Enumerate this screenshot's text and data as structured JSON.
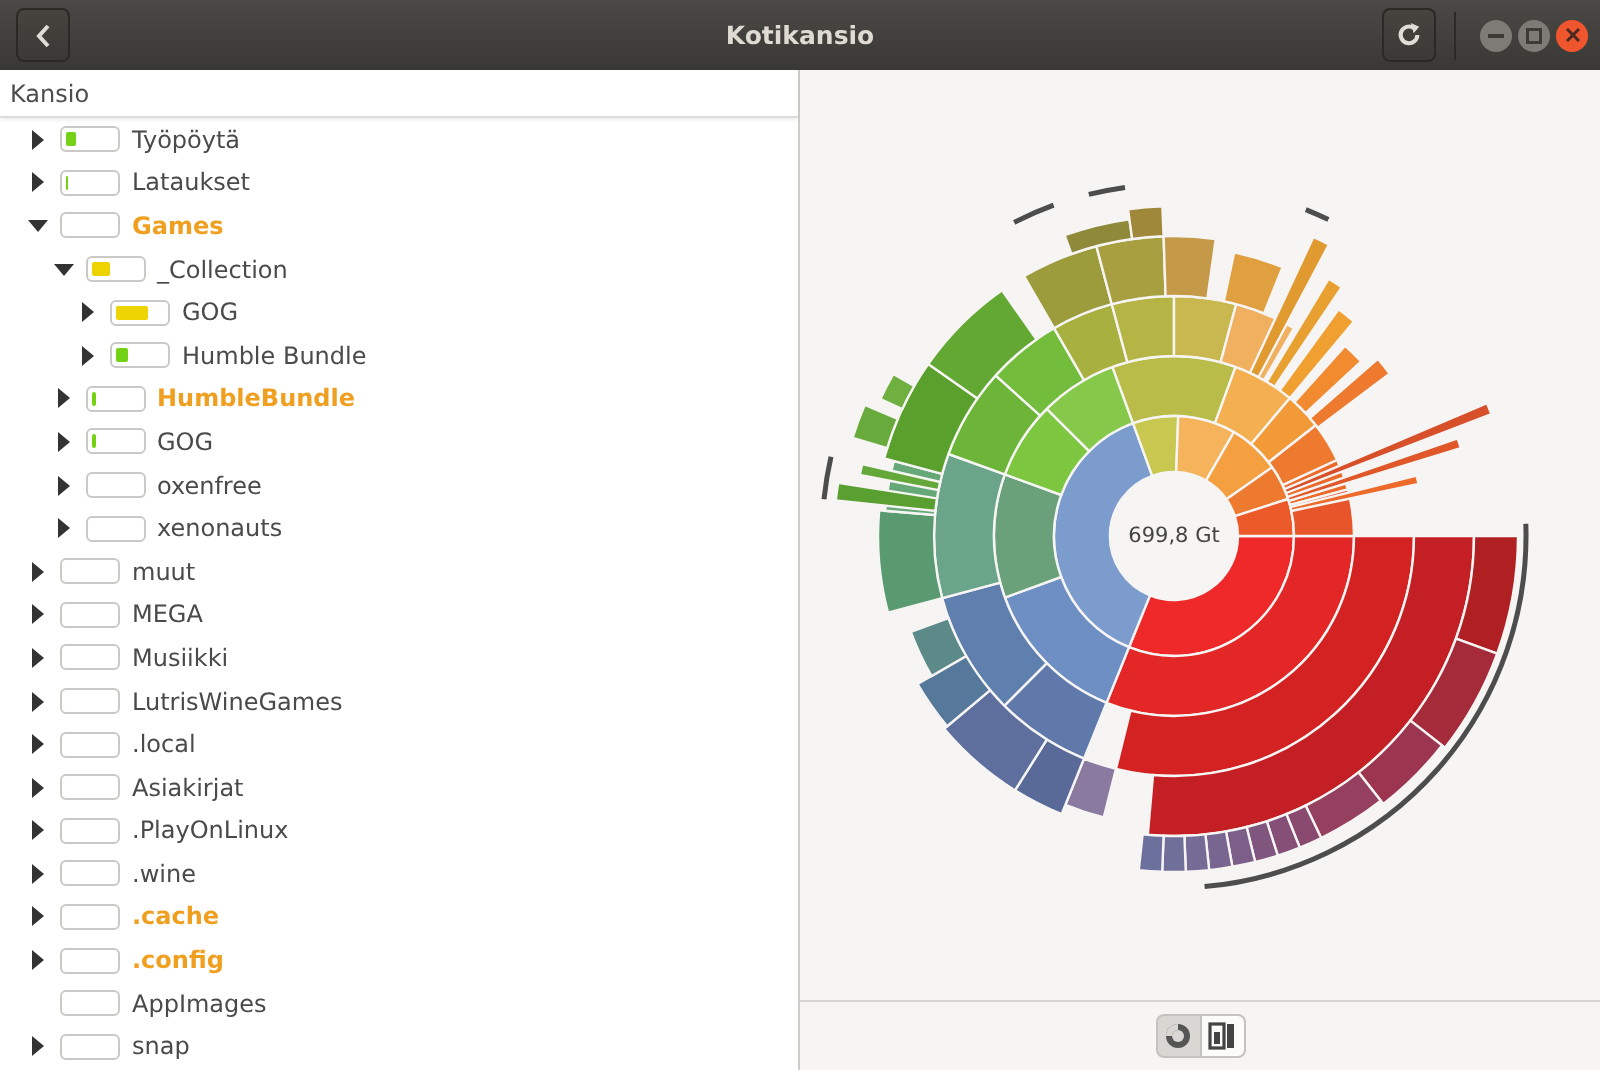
{
  "window": {
    "title": "Kotikansio"
  },
  "tree": {
    "column_header": "Kansio",
    "rows": [
      {
        "name": "Työpöytä",
        "level": 0.2,
        "color": "#73d216",
        "expandable": true,
        "expanded": false,
        "highlighted": false
      },
      {
        "name": "Lataukset",
        "level": 0.06,
        "color": "#73d216",
        "expandable": true,
        "expanded": false,
        "highlighted": false
      },
      {
        "name": "Games",
        "expandable": true,
        "expanded": true,
        "highlighted": true,
        "children": [
          {
            "name": "_Collection",
            "level": 0.4,
            "color": "#edd400",
            "expandable": true,
            "expanded": true,
            "highlighted": false,
            "children": [
              {
                "name": "GOG",
                "level": 0.65,
                "color": "#edd400",
                "expandable": true,
                "expanded": false,
                "highlighted": false
              },
              {
                "name": "Humble Bundle",
                "level": 0.25,
                "color": "#73d216",
                "expandable": true,
                "expanded": false,
                "highlighted": false
              }
            ]
          },
          {
            "name": "HumbleBundle",
            "level": 0.1,
            "color": "#73d216",
            "expandable": true,
            "expanded": false,
            "highlighted": true
          },
          {
            "name": "GOG",
            "level": 0.1,
            "color": "#73d216",
            "expandable": true,
            "expanded": false,
            "highlighted": false
          },
          {
            "name": "oxenfree",
            "expandable": true,
            "expanded": false,
            "highlighted": false
          },
          {
            "name": "xenonauts",
            "expandable": true,
            "expanded": false,
            "highlighted": false
          }
        ]
      },
      {
        "name": "muut",
        "expandable": true,
        "expanded": false,
        "highlighted": false
      },
      {
        "name": "MEGA",
        "expandable": true,
        "expanded": false,
        "highlighted": false
      },
      {
        "name": "Musiikki",
        "expandable": true,
        "expanded": false,
        "highlighted": false
      },
      {
        "name": "LutrisWineGames",
        "expandable": true,
        "expanded": false,
        "highlighted": false
      },
      {
        "name": ".local",
        "expandable": true,
        "expanded": false,
        "highlighted": false
      },
      {
        "name": "Asiakirjat",
        "expandable": true,
        "expanded": false,
        "highlighted": false
      },
      {
        "name": ".PlayOnLinux",
        "expandable": true,
        "expanded": false,
        "highlighted": false
      },
      {
        "name": ".wine",
        "expandable": true,
        "expanded": false,
        "highlighted": false
      },
      {
        "name": ".cache",
        "expandable": true,
        "expanded": false,
        "highlighted": true
      },
      {
        "name": ".config",
        "expandable": true,
        "expanded": false,
        "highlighted": true
      },
      {
        "name": "AppImages",
        "expandable": false,
        "expanded": false,
        "highlighted": false
      },
      {
        "name": "snap",
        "expandable": true,
        "expanded": false,
        "highlighted": false
      }
    ]
  },
  "chart": {
    "center_label": "699,8 Gt"
  },
  "view_buttons": [
    {
      "kind": "rings",
      "selected": true
    },
    {
      "kind": "treemap",
      "selected": false
    }
  ]
}
